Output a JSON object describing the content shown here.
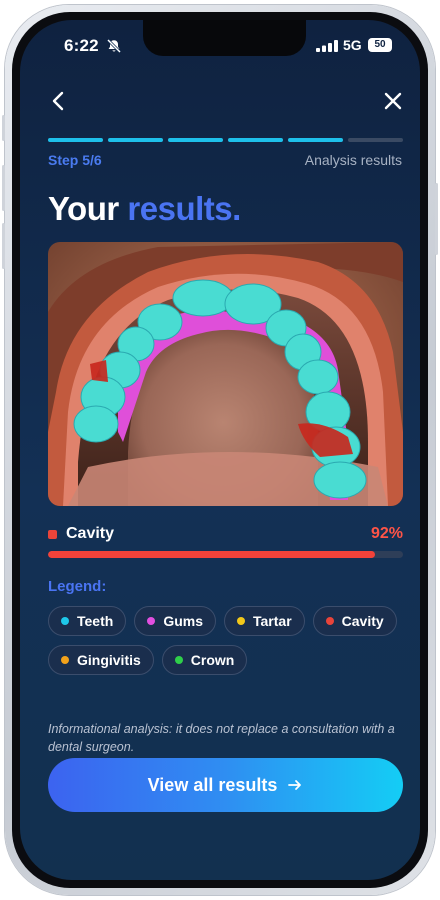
{
  "status": {
    "time": "6:22",
    "network": "5G",
    "battery": "50"
  },
  "header": {
    "step_label": "Step 5/6",
    "step_title": "Analysis results",
    "total_steps": 6,
    "current_step": 5
  },
  "title": {
    "prefix": "Your",
    "accent": "results."
  },
  "result": {
    "name": "Cavity",
    "percent_text": "92%",
    "percent": 92,
    "color": "#e9443a"
  },
  "legend": {
    "title": "Legend:",
    "items": [
      {
        "label": "Teeth",
        "color": "#1ec8ea"
      },
      {
        "label": "Gums",
        "color": "#e24fe0"
      },
      {
        "label": "Tartar",
        "color": "#f2c81a"
      },
      {
        "label": "Cavity",
        "color": "#e9443a"
      },
      {
        "label": "Gingivitis",
        "color": "#f2a21a"
      },
      {
        "label": "Crown",
        "color": "#2fcf4a"
      }
    ]
  },
  "disclaimer": "Informational analysis: it does not replace a consultation with a dental surgeon.",
  "cta": {
    "label": "View all results"
  },
  "icons": {
    "back": "chevron-left-icon",
    "close": "close-icon",
    "arrow": "arrow-right-icon",
    "bell": "bell-slash-icon"
  }
}
